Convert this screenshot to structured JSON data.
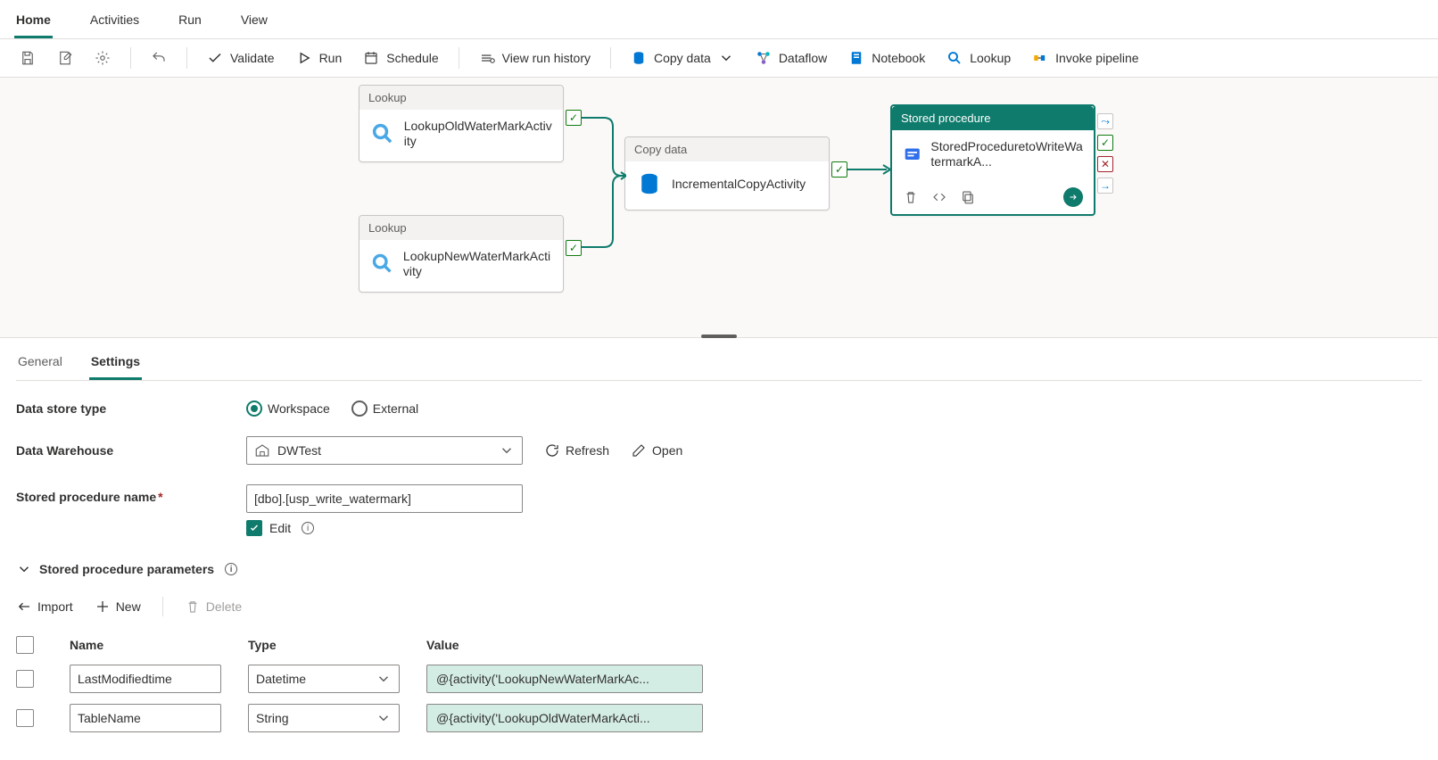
{
  "menu": {
    "tabs": [
      "Home",
      "Activities",
      "Run",
      "View"
    ],
    "active": 0
  },
  "toolbar": {
    "validate": "Validate",
    "run": "Run",
    "schedule": "Schedule",
    "view_run_history": "View run history",
    "copy_data": "Copy data",
    "dataflow": "Dataflow",
    "notebook": "Notebook",
    "lookup": "Lookup",
    "invoke_pipeline": "Invoke pipeline"
  },
  "nodes": {
    "lookup1": {
      "type": "Lookup",
      "title": "LookupOldWaterMarkActivity"
    },
    "lookup2": {
      "type": "Lookup",
      "title": "LookupNewWaterMarkActivity"
    },
    "copy": {
      "type": "Copy data",
      "title": "IncrementalCopyActivity"
    },
    "sproc": {
      "type": "Stored procedure",
      "title": "StoredProceduretoWriteWatermarkA..."
    }
  },
  "panel": {
    "tabs": [
      "General",
      "Settings"
    ],
    "active": 1,
    "form": {
      "data_store_type_label": "Data store type",
      "data_store_options": {
        "workspace": "Workspace",
        "external": "External"
      },
      "data_warehouse_label": "Data Warehouse",
      "data_warehouse_value": "DWTest",
      "refresh": "Refresh",
      "open": "Open",
      "sproc_name_label": "Stored procedure name",
      "sproc_name_value": "[dbo].[usp_write_watermark]",
      "edit": "Edit",
      "params_section": "Stored procedure parameters",
      "actions": {
        "import": "Import",
        "new": "New",
        "delete": "Delete"
      },
      "columns": {
        "name": "Name",
        "type": "Type",
        "value": "Value"
      },
      "rows": [
        {
          "name": "LastModifiedtime",
          "type": "Datetime",
          "value": "@{activity('LookupNewWaterMarkAc..."
        },
        {
          "name": "TableName",
          "type": "String",
          "value": "@{activity('LookupOldWaterMarkActi..."
        }
      ]
    }
  }
}
